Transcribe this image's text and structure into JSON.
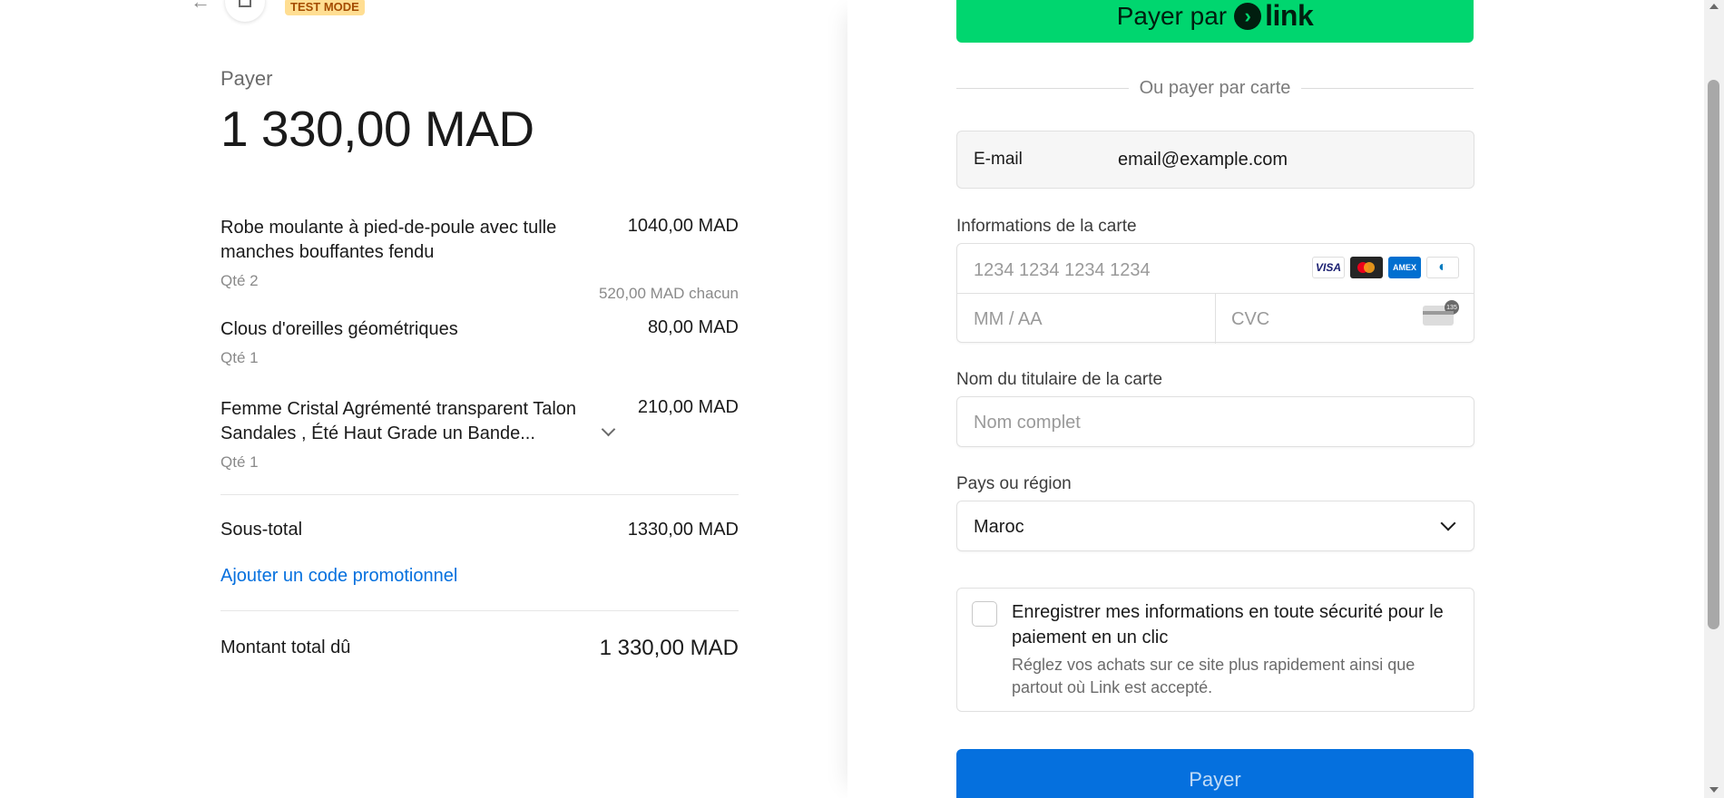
{
  "header": {
    "back_icon": "arrow-left-icon",
    "store_icon": "store-icon",
    "test_badge": "TEST MODE"
  },
  "summary": {
    "pay_label": "Payer",
    "pay_amount": "1 330,00 MAD",
    "items": [
      {
        "name": "Robe moulante à pied-de-poule avec tulle manches bouffantes fendu",
        "price": "1040,00 MAD",
        "qty": "Qté 2",
        "each": "520,00 MAD chacun"
      },
      {
        "name": "Clous d'oreilles géométriques",
        "price": "80,00 MAD",
        "qty": "Qté 1"
      },
      {
        "name": "Femme Cristal Agrémenté transparent Talon Sandales , Été Haut Grade un Bande...",
        "price": "210,00 MAD",
        "qty": "Qté 1"
      }
    ],
    "subtotal_label": "Sous-total",
    "subtotal_value": "1330,00 MAD",
    "promo_link": "Ajouter un code promotionnel",
    "total_label": "Montant total dû",
    "total_value": "1 330,00 MAD"
  },
  "payment": {
    "link_button_prefix": "Payer par",
    "link_brand": "link",
    "divider_text": "Ou payer par carte",
    "email_label": "E-mail",
    "email_value": "email@example.com",
    "card_label": "Informations de la carte",
    "card_number_placeholder": "1234 1234 1234 1234",
    "card_brands": [
      "VISA",
      "mastercard",
      "AMEX",
      "diners"
    ],
    "expiry_placeholder": "MM / AA",
    "cvc_placeholder": "CVC",
    "name_label": "Nom du titulaire de la carte",
    "name_placeholder": "Nom complet",
    "country_label": "Pays ou région",
    "country_value": "Maroc",
    "save_title": "Enregistrer mes informations en toute sécurité pour le paiement en un clic",
    "save_desc": "Réglez vos achats sur ce site plus rapidement ainsi que partout où Link est accepté.",
    "pay_button": "Payer"
  },
  "colors": {
    "link_green": "#00d66f",
    "primary_blue": "#0570de",
    "test_badge_bg": "#ffde92"
  }
}
